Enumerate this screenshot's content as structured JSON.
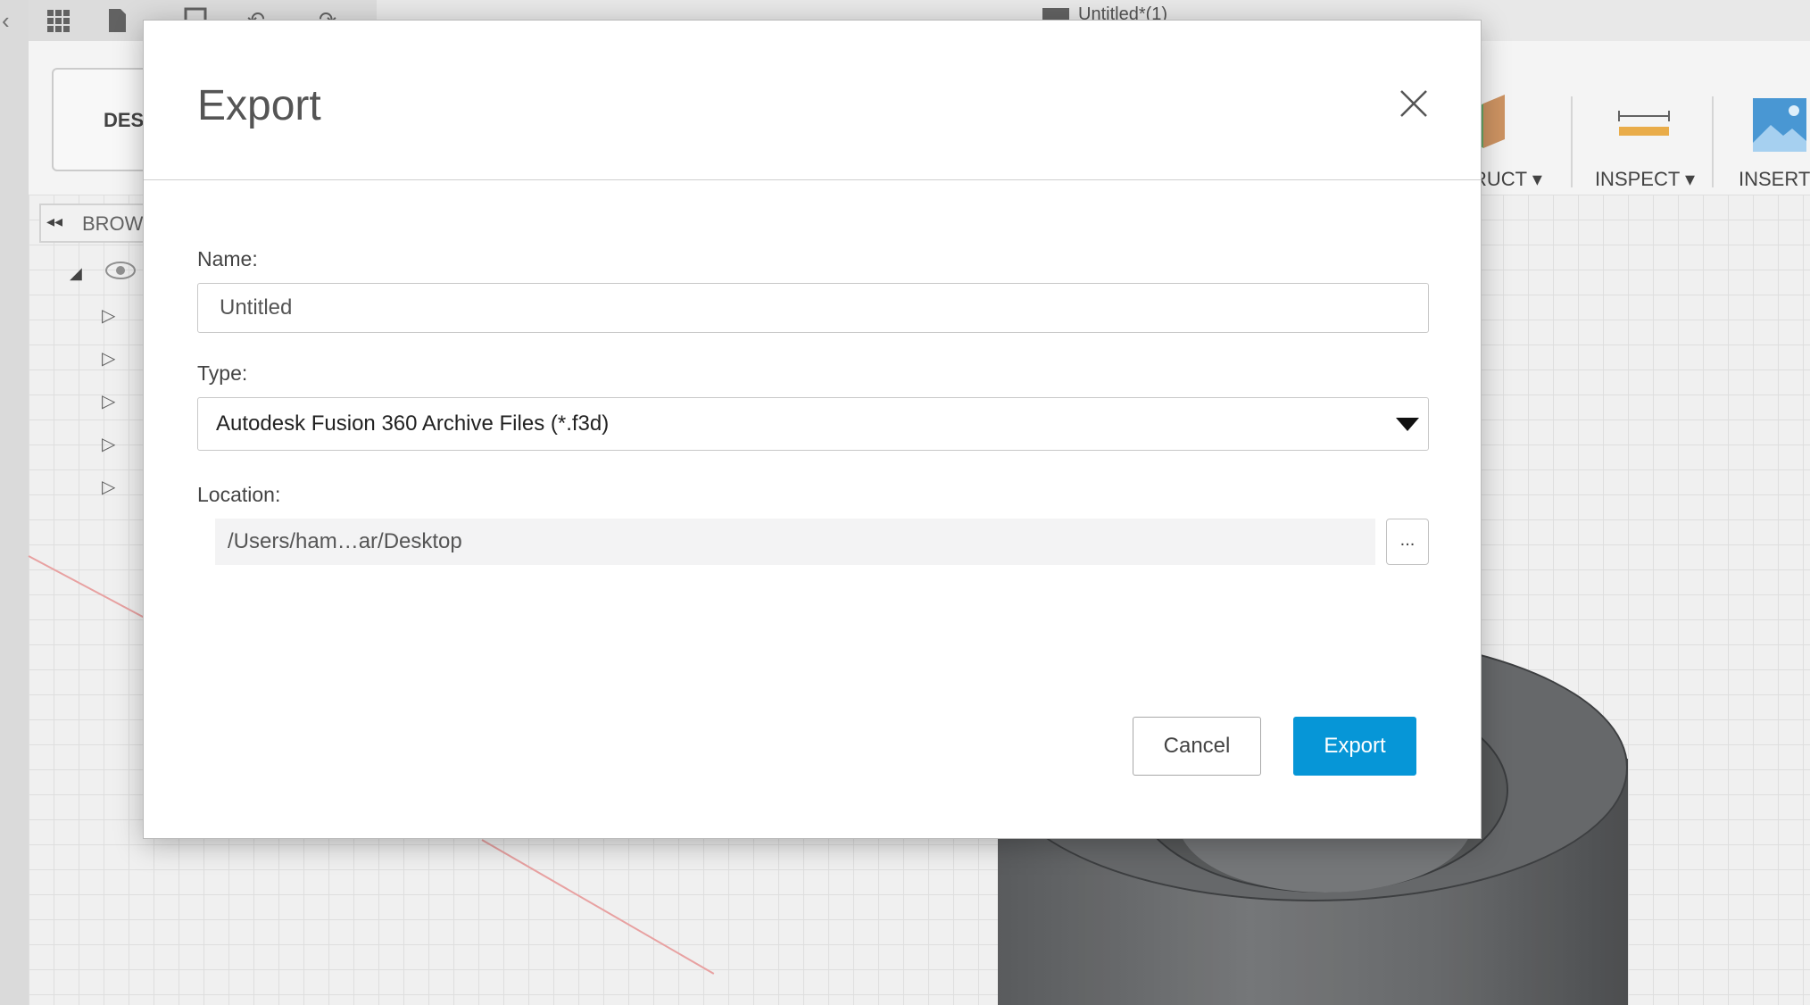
{
  "app": {
    "workspace_label": "DES",
    "doc_title": "Untitled*(1)",
    "browser_label": "BROWS",
    "ribbon": {
      "construct_label": "RUCT ▾",
      "inspect_label": "INSPECT ▾",
      "insert_label": "INSERT"
    }
  },
  "dialog": {
    "title": "Export",
    "name_label": "Name:",
    "name_value": "Untitled",
    "type_label": "Type:",
    "type_selected": "Autodesk Fusion 360 Archive Files (*.f3d)",
    "location_label": "Location:",
    "location_value": "/Users/ham…ar/Desktop",
    "browse_label": "...",
    "cancel_label": "Cancel",
    "export_label": "Export",
    "colors": {
      "primary": "#0696d7"
    }
  }
}
